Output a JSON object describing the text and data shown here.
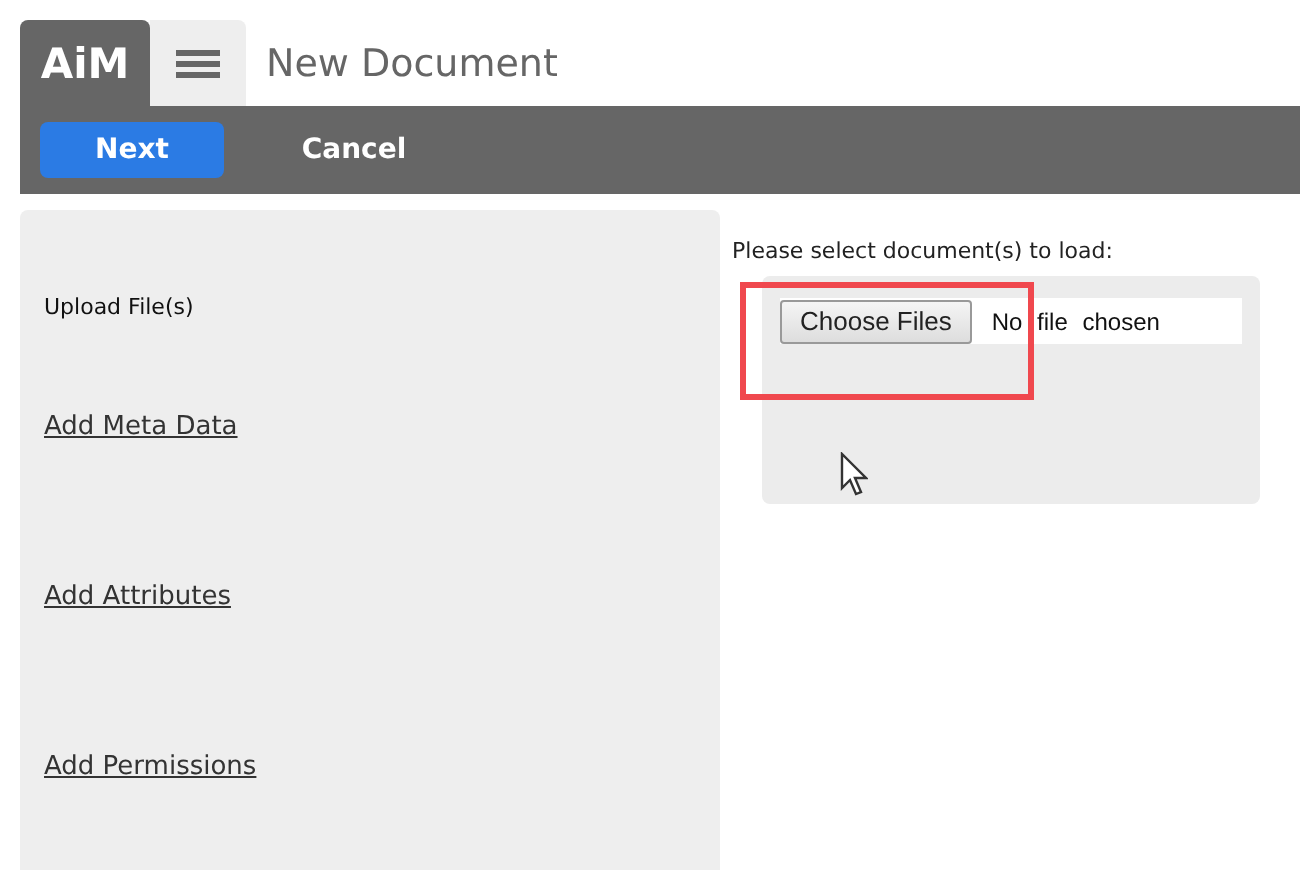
{
  "app": {
    "logo": "AiM",
    "title": "New Document"
  },
  "toolbar": {
    "buttons": [
      {
        "label": "Next",
        "kind": "primary"
      },
      {
        "label": "Cancel",
        "kind": "plain"
      }
    ]
  },
  "sidebar": {
    "items": [
      {
        "label": "Upload File(s)",
        "kind": "text"
      },
      {
        "label": "Add Meta Data",
        "kind": "link"
      },
      {
        "label": "Add Attributes",
        "kind": "link"
      },
      {
        "label": "Add Permissions",
        "kind": "link"
      }
    ]
  },
  "upload": {
    "label": "Please select document(s) to load:",
    "button": "Choose Files",
    "status": "No file chosen"
  }
}
